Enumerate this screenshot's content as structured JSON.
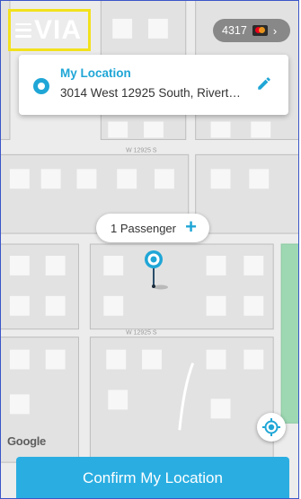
{
  "brand": {
    "logo_text": "VIA",
    "accent": "#1fa6d6",
    "button_color": "#2aaee2"
  },
  "header": {
    "menu_icon": "hamburger-menu-icon",
    "payment": {
      "card_suffix": "4317",
      "card_icon": "mastercard-icon",
      "chevron_icon": "chevron-right-icon"
    }
  },
  "pickup": {
    "title": "My Location",
    "address": "3014 West 12925 South, Rivert…",
    "icon": "location-target-icon",
    "edit_icon": "pencil-edit-icon"
  },
  "passengers": {
    "label": "1 Passenger",
    "add_icon": "plus-icon"
  },
  "map": {
    "street_labels": [
      "W 12925 S",
      "W 12925 S"
    ],
    "pin_icon": "map-pin-icon",
    "recenter_icon": "my-location-icon",
    "attribution": "Google"
  },
  "footer": {
    "confirm_label": "Confirm My Location"
  }
}
